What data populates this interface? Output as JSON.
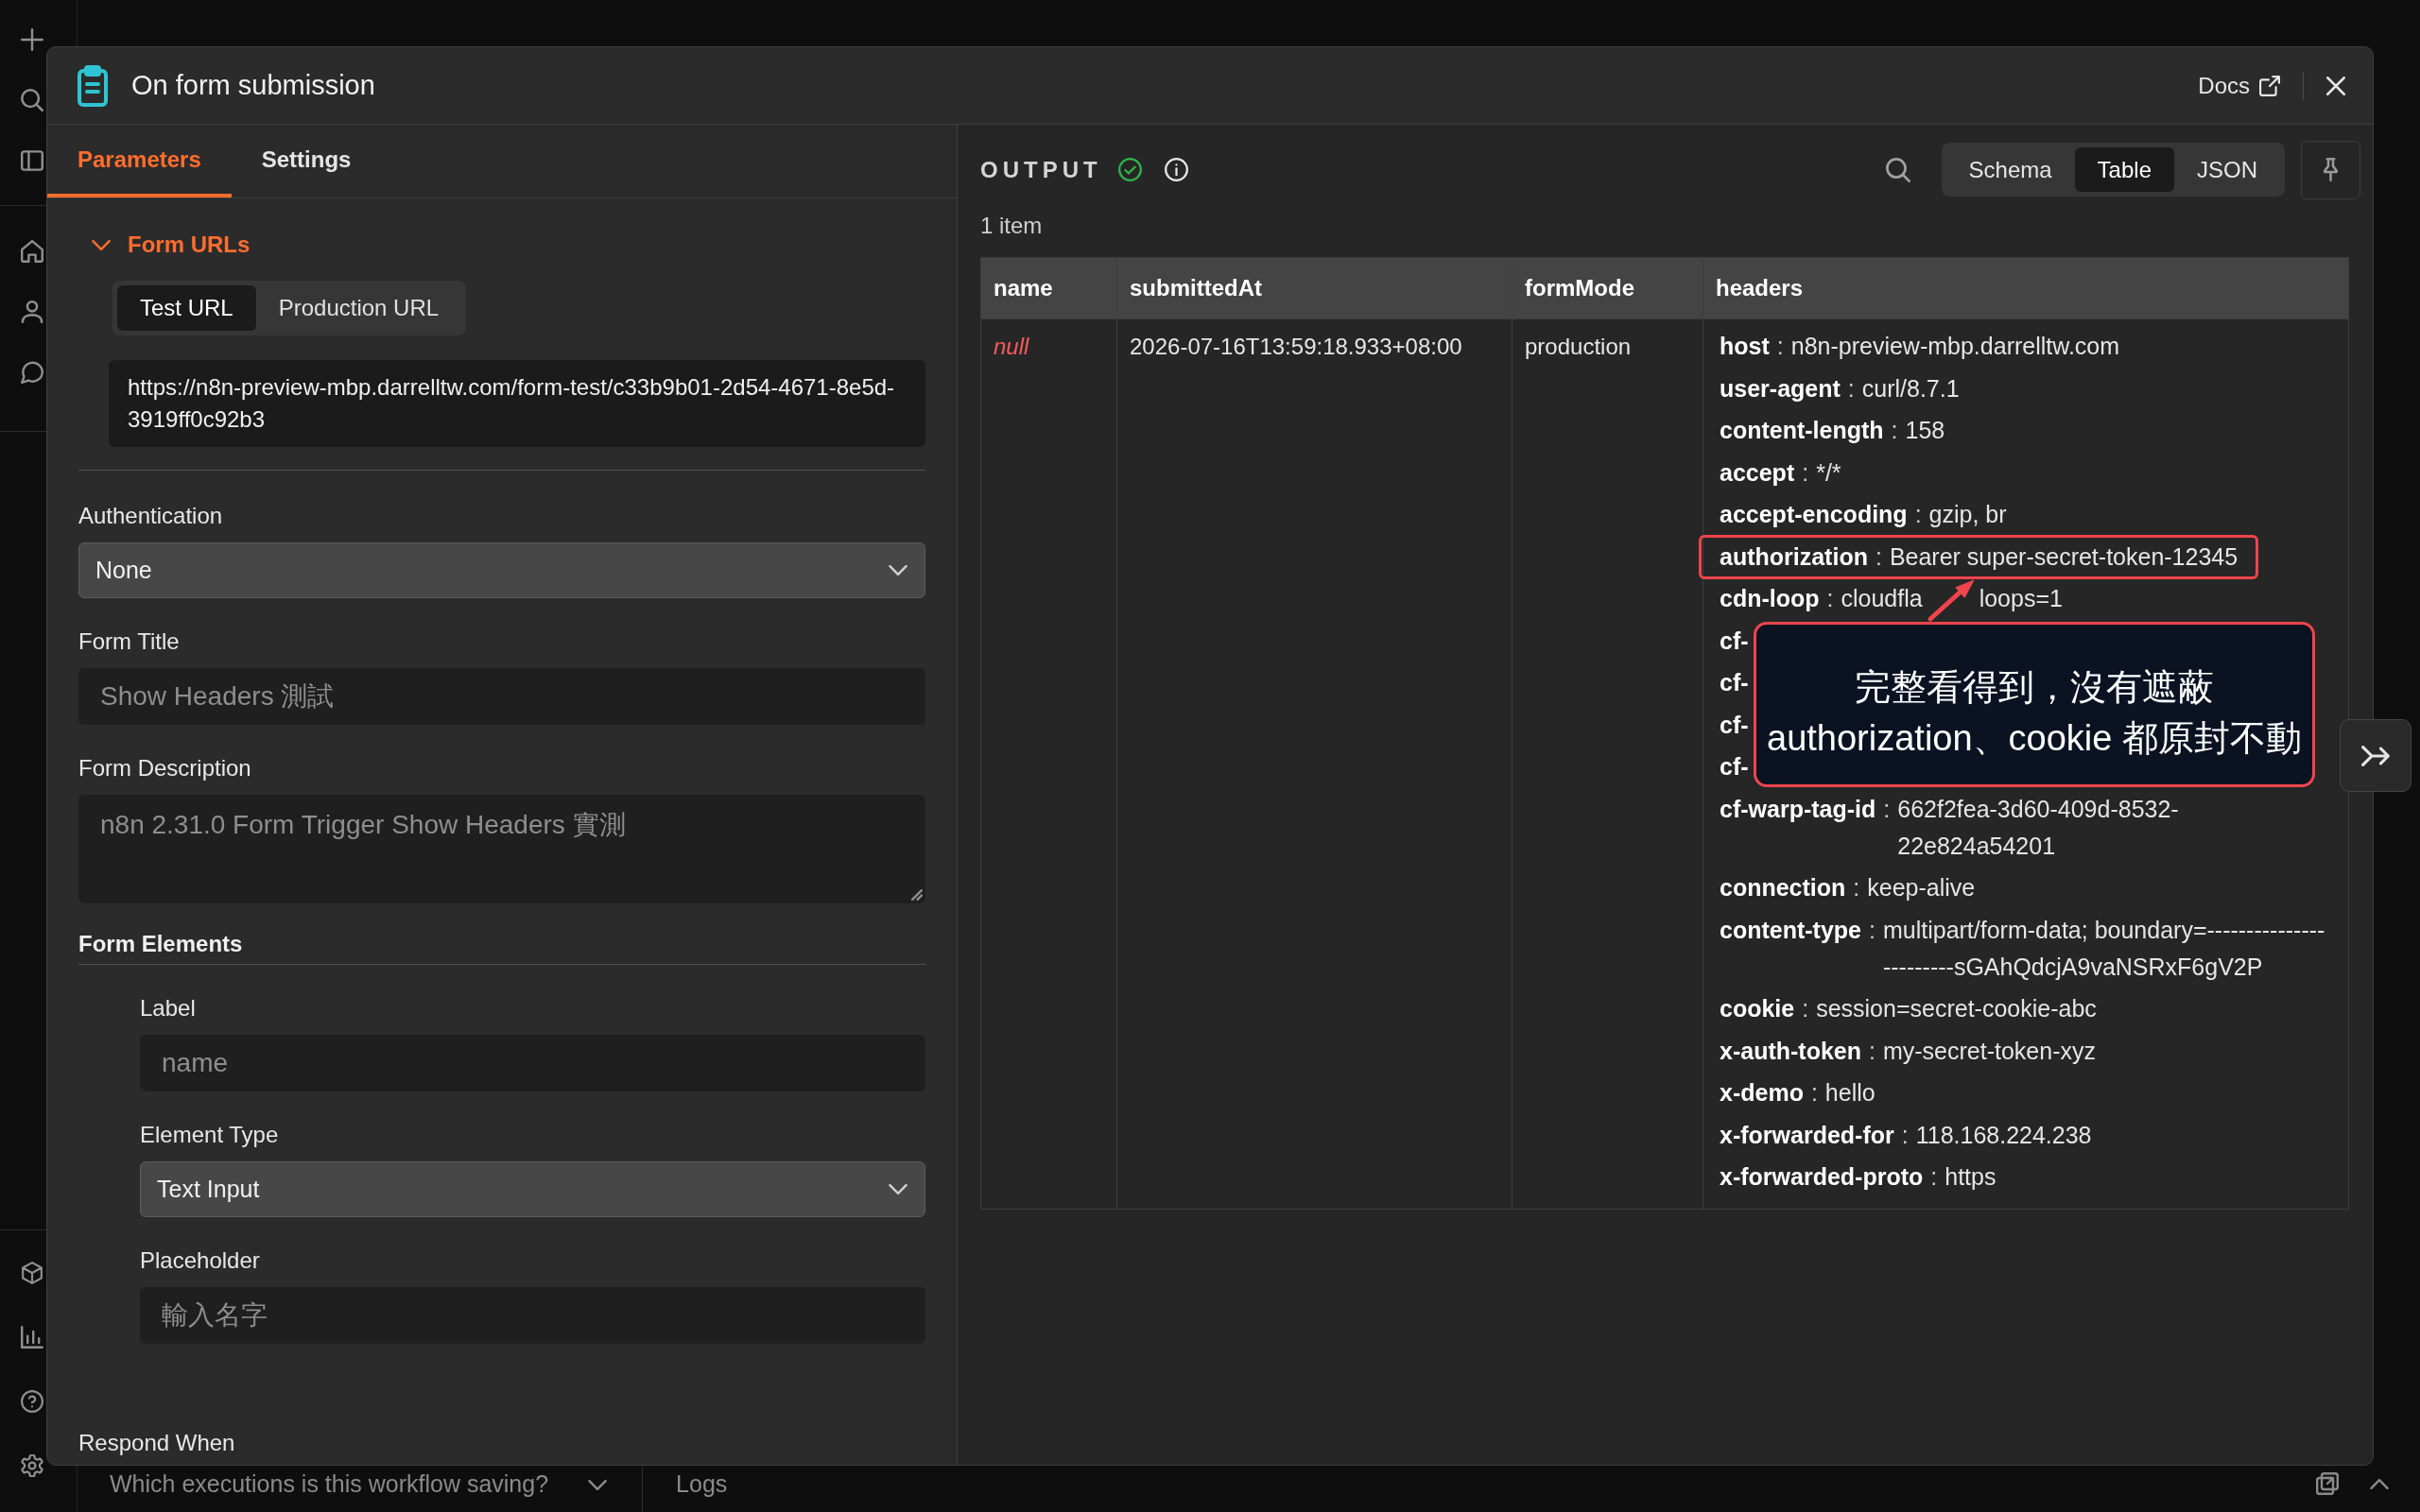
{
  "node_modal": {
    "title": "On form submission",
    "docs_link": "Docs",
    "parameters_panel": {
      "tabs": [
        {
          "label": "Parameters",
          "selected": true
        },
        {
          "label": "Settings",
          "selected": false
        }
      ],
      "form_urls": {
        "title": "Form URLs",
        "expanded": true,
        "url_tabs": [
          {
            "label": "Test URL",
            "selected": true
          },
          {
            "label": "Production URL",
            "selected": false
          }
        ],
        "url": "https://n8n-preview-mbp.darrelltw.com/form-test/c33b9b01-2d54-4671-8e5d-3919ff0c92b3"
      },
      "fields": [
        {
          "kind": "select",
          "label": "Authentication",
          "value": "None"
        },
        {
          "kind": "input",
          "label": "Form Title",
          "value": "Show Headers 測試"
        },
        {
          "kind": "textarea",
          "label": "Form Description",
          "value": "n8n 2.31.0 Form Trigger Show Headers 實測"
        }
      ],
      "form_elements": {
        "title": "Form Elements",
        "fields": [
          {
            "kind": "input",
            "label": "Label",
            "value": "name"
          },
          {
            "kind": "select",
            "label": "Element Type",
            "value": "Text Input"
          },
          {
            "kind": "input",
            "label": "Placeholder",
            "value": "輸入名字"
          }
        ]
      },
      "next_field_label": "Respond When"
    },
    "output_panel": {
      "title": "OUTPUT",
      "view_tabs": [
        {
          "label": "Schema",
          "selected": false
        },
        {
          "label": "Table",
          "selected": true
        },
        {
          "label": "JSON",
          "selected": false
        }
      ],
      "item_count": "1 item",
      "table": {
        "columns": [
          "name",
          "submittedAt",
          "formMode",
          "headers"
        ],
        "rows": [
          {
            "cells": [
              {
                "kind": "null",
                "text": "null"
              },
              {
                "kind": "text",
                "text": "2026-07-16T13:59:18.933+08:00"
              },
              {
                "kind": "text",
                "text": "production"
              },
              {
                "kind": "object",
                "entries": [
                  {
                    "key": "host",
                    "separator": ":",
                    "value": "n8n-preview-mbp.darrelltw.com",
                    "highlighted": false
                  },
                  {
                    "key": "user-agent",
                    "separator": ":",
                    "value": "curl/8.7.1",
                    "highlighted": false
                  },
                  {
                    "key": "content-length",
                    "separator": ":",
                    "value": "158",
                    "highlighted": false
                  },
                  {
                    "key": "accept",
                    "separator": ":",
                    "value": "*/*",
                    "highlighted": false
                  },
                  {
                    "key": "accept-encoding",
                    "separator": ":",
                    "value": "gzip, br",
                    "highlighted": false
                  },
                  {
                    "key": "authorization",
                    "separator": ":",
                    "value": "Bearer super-secret-token-12345",
                    "highlighted": true
                  },
                  {
                    "key": "cdn-loop",
                    "separator": ":",
                    "value": "cloudfla",
                    "value_after_arrow": "loops=1",
                    "highlighted": false
                  },
                  {
                    "key": "cf-",
                    "highlighted": false
                  },
                  {
                    "key": "cf-",
                    "highlighted": false
                  },
                  {
                    "key": "cf-",
                    "highlighted": false
                  },
                  {
                    "key": "cf-",
                    "highlighted": false
                  },
                  {
                    "key": "cf-warp-tag-id",
                    "separator": ":",
                    "value": "662f2fea-3d60-409d-8532-22e824a54201",
                    "highlighted": false
                  },
                  {
                    "key": "connection",
                    "separator": ":",
                    "value": "keep-alive",
                    "highlighted": false
                  },
                  {
                    "key": "content-type",
                    "separator": ":",
                    "value": "multipart/form-data; boundary=------------------------sGAhQdcjA9vaNSRxF6gV2P",
                    "highlighted": false
                  },
                  {
                    "key": "cookie",
                    "separator": ":",
                    "value": "session=secret-cookie-abc",
                    "highlighted": false
                  },
                  {
                    "key": "x-auth-token",
                    "separator": ":",
                    "value": "my-secret-token-xyz",
                    "highlighted": false
                  },
                  {
                    "key": "x-demo",
                    "separator": ":",
                    "value": "hello",
                    "highlighted": false
                  },
                  {
                    "key": "x-forwarded-for",
                    "separator": ":",
                    "value": "118.168.224.238",
                    "highlighted": false
                  },
                  {
                    "key": "x-forwarded-proto",
                    "separator": ":",
                    "value": "https",
                    "highlighted": false
                  }
                ]
              }
            ]
          }
        ]
      }
    }
  },
  "annotation": {
    "lines": [
      "完整看得到，沒有遮蔽",
      "authorization、cookie 都原封不動"
    ]
  },
  "bottom_bar": {
    "executions_filter": "Which executions is this workflow saving?",
    "logs_tab": "Logs"
  }
}
